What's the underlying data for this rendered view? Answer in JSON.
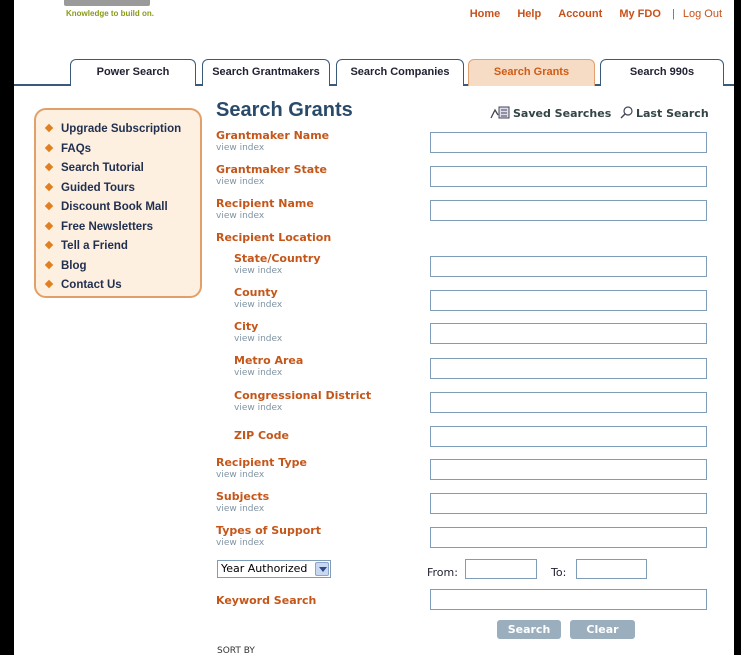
{
  "header": {
    "tagline": "Knowledge to build on.",
    "nav": [
      "Home",
      "Help",
      "Account",
      "My FDO"
    ],
    "logout": "Log Out",
    "separator": "|"
  },
  "tabs": [
    {
      "label": "Power Search",
      "active": false
    },
    {
      "label": "Search Grantmakers",
      "active": false
    },
    {
      "label": "Search Companies",
      "active": false
    },
    {
      "label": "Search Grants",
      "active": true
    },
    {
      "label": "Search 990s",
      "active": false
    }
  ],
  "sidebar": {
    "items": [
      {
        "label": "Upgrade Subscription"
      },
      {
        "label": "FAQs"
      },
      {
        "label": "Search Tutorial"
      },
      {
        "label": "Guided Tours"
      },
      {
        "label": "Discount Book Mall"
      },
      {
        "label": "Free Newsletters"
      },
      {
        "label": "Tell a Friend"
      },
      {
        "label": "Blog"
      },
      {
        "label": "Contact Us"
      }
    ]
  },
  "main": {
    "title": "Search Grants",
    "saved_searches": "Saved Searches",
    "last_search": "Last Search",
    "view_index": "view index",
    "fields": {
      "grantmaker_name": "Grantmaker Name",
      "grantmaker_state": "Grantmaker State",
      "recipient_name": "Recipient Name",
      "recipient_location": "Recipient Location",
      "state_country": "State/Country",
      "county": "County",
      "city": "City",
      "metro_area": "Metro Area",
      "congressional_district": "Congressional District",
      "zip_code": "ZIP Code",
      "recipient_type": "Recipient Type",
      "subjects": "Subjects",
      "types_of_support": "Types of Support",
      "keyword_search": "Keyword Search"
    },
    "year_select": "Year Authorized",
    "from_label": "From:",
    "to_label": "To:",
    "search_button": "Search",
    "clear_button": "Clear",
    "sort_by": "SORT BY"
  },
  "colors": {
    "accent_orange": "#c4561a",
    "nav_blue": "#2a4a6a",
    "sidebar_bg": "#fdf0e0",
    "button_grey": "#9aaebe"
  }
}
